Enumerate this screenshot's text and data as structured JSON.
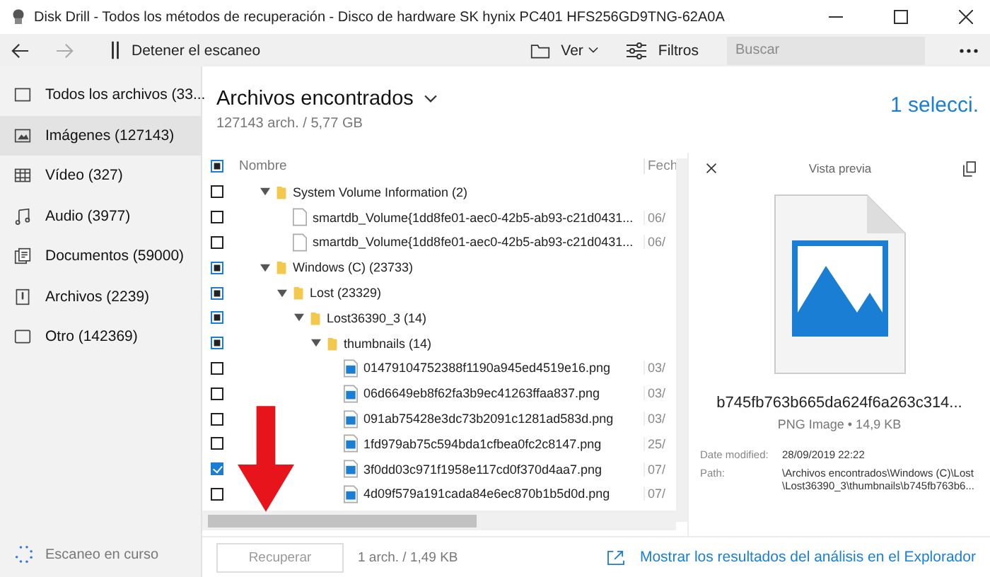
{
  "window": {
    "title": "Disk Drill - Todos los métodos de recuperación - Disco de hardware SK hynix PC401 HFS256GD9TNG-62A0A"
  },
  "toolbar": {
    "stop_label": "Detener el escaneo",
    "view_label": "Ver",
    "filters_label": "Filtros",
    "search": {
      "placeholder": "Buscar"
    }
  },
  "sidebar": {
    "items": [
      {
        "label": "Todos los archivos (33...",
        "kind": "all",
        "selected": false
      },
      {
        "label": "Imágenes (127143)",
        "kind": "images",
        "selected": true
      },
      {
        "label": "Vídeo (327)",
        "kind": "video",
        "selected": false
      },
      {
        "label": "Audio (3977)",
        "kind": "audio",
        "selected": false
      },
      {
        "label": "Documentos (59000)",
        "kind": "documents",
        "selected": false
      },
      {
        "label": "Archivos (2239)",
        "kind": "archives",
        "selected": false
      },
      {
        "label": "Otro (142369)",
        "kind": "other",
        "selected": false
      }
    ],
    "status": "Escaneo en curso"
  },
  "header": {
    "title": "Archivos encontrados",
    "summary": "127143 arch. / 5,77 GB",
    "selection": "1 selecci."
  },
  "table": {
    "columns": [
      "Nombre",
      "Fech"
    ],
    "header_checked": true,
    "header_partial": true,
    "rows": [
      {
        "name": "System Volume Information (2)",
        "kind": "folder",
        "checked": false,
        "partial": false,
        "expanded": true,
        "children": [
          {
            "name": "smartdb_Volume{1dd8fe01-aec0-42b5-ab93-c21d0431...",
            "kind": "file",
            "checked": false,
            "date": "06/"
          },
          {
            "name": "smartdb_Volume{1dd8fe01-aec0-42b5-ab93-c21d0431...",
            "kind": "file",
            "checked": false,
            "date": "06/"
          }
        ]
      },
      {
        "name": "Windows (C) (23733)",
        "kind": "folder",
        "checked": true,
        "partial": true,
        "expanded": true,
        "children": [
          {
            "name": "Lost (23329)",
            "kind": "folder",
            "checked": true,
            "partial": true,
            "expanded": true,
            "children": [
              {
                "name": "Lost36390_3 (14)",
                "kind": "folder",
                "checked": true,
                "partial": true,
                "expanded": true,
                "children": [
                  {
                    "name": "thumbnails (14)",
                    "kind": "folder",
                    "checked": true,
                    "partial": true,
                    "expanded": true,
                    "children": [
                      {
                        "name": "01479104752388f1190a945ed4519e16.png",
                        "kind": "image",
                        "checked": false,
                        "date": "03/"
                      },
                      {
                        "name": "06d6649eb8f62fa3b9ec41263ffaa837.png",
                        "kind": "image",
                        "checked": false,
                        "date": "03/"
                      },
                      {
                        "name": "091ab75428e3dc73b2091c1281ad583d.png",
                        "kind": "image",
                        "checked": false,
                        "date": "03/"
                      },
                      {
                        "name": "1fd979ab75c594bda1cfbea0fc2c8147.png",
                        "kind": "image",
                        "checked": false,
                        "date": "25/"
                      },
                      {
                        "name": "3f0dd03c971f1958e117cd0f370d4aa7.png",
                        "kind": "image",
                        "checked": true,
                        "date": "07/"
                      },
                      {
                        "name": "4d09f579a191cada84e6ec870b1b5d0d.png",
                        "kind": "image",
                        "checked": false,
                        "date": "07/"
                      }
                    ]
                  }
                ]
              }
            ]
          }
        ]
      }
    ]
  },
  "preview": {
    "title": "Vista previa",
    "file_name": "b745fb763b665da624f6a263c314...",
    "file_info": "PNG Image • 14,9 KB",
    "details": [
      {
        "label": "Date modified:",
        "lines": [
          "28/09/2019 22:22"
        ]
      },
      {
        "label": "Path:",
        "lines": [
          "\\Archivos encontrados\\Windows (C)\\Lost",
          "\\Lost36390_3\\thumbnails\\b745fb763b6..."
        ]
      }
    ]
  },
  "footer": {
    "recover_label": "Recuperar",
    "recover_disabled": true,
    "selection_size": "1 arch. / 1,49 KB",
    "explorer_link": "Mostrar los resultados del análisis en el Explorador"
  }
}
